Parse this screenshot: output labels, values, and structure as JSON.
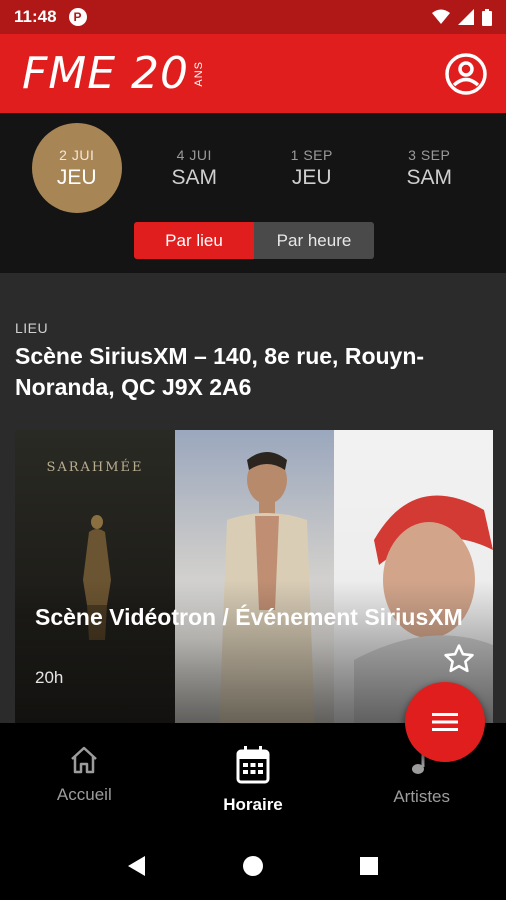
{
  "status_bar": {
    "time": "11:48",
    "app_badge": "P"
  },
  "header": {
    "logo_main": "FME 20",
    "logo_sub": "ANS"
  },
  "dates": [
    {
      "day": "2 JUI",
      "weekday": "JEU",
      "selected": true
    },
    {
      "day": "4 JUI",
      "weekday": "SAM",
      "selected": false
    },
    {
      "day": "1 SEP",
      "weekday": "JEU",
      "selected": false
    },
    {
      "day": "3 SEP",
      "weekday": "SAM",
      "selected": false
    }
  ],
  "view_toggle": {
    "by_venue": "Par lieu",
    "by_time": "Par heure",
    "selected": "by_venue"
  },
  "venue": {
    "label": "LIEU",
    "name": "Scène SiriusXM – 140, 8e rue, Rouyn-Noranda, QC J9X 2A6"
  },
  "event_card": {
    "poster_text": "SARAHMÉE",
    "title": "Scène Vidéotron / Événement SiriusXM",
    "time": "20h"
  },
  "bottom_nav": {
    "items": [
      {
        "label": "Accueil",
        "icon": "home-icon",
        "active": false
      },
      {
        "label": "Horaire",
        "icon": "calendar-icon",
        "active": true
      },
      {
        "label": "Artistes",
        "icon": "music-note-icon",
        "active": false
      }
    ]
  },
  "colors": {
    "brand_red": "#e01e1e",
    "status_red": "#b01818",
    "date_gold": "#a88555",
    "content_bg": "#2b2b2b"
  }
}
